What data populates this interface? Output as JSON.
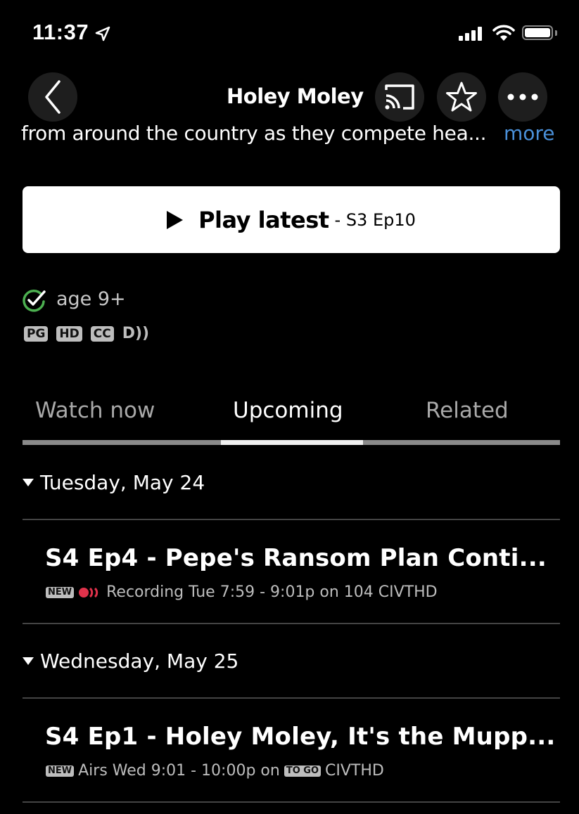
{
  "status_bar": {
    "time": "11:37",
    "icons": [
      "location-arrow-icon",
      "cellular-signal-icon",
      "wifi-icon",
      "battery-icon"
    ]
  },
  "header": {
    "title": "Holey Moley",
    "back_icon": "chevron-left-icon",
    "cast_icon": "cast-icon",
    "favorite_icon": "star-icon",
    "more_icon": "ellipsis-icon"
  },
  "description": {
    "text": "from around the country as they compete hea...",
    "more_label": "more"
  },
  "play_button": {
    "label": "Play latest",
    "episode": "- S3 Ep10"
  },
  "rating": {
    "age_label": "age 9+",
    "badges": [
      "PG",
      "HD",
      "CC"
    ],
    "audio_desc": "D))"
  },
  "tabs": [
    {
      "label": "Watch now",
      "active": false
    },
    {
      "label": "Upcoming",
      "active": true
    },
    {
      "label": "Related",
      "active": false
    }
  ],
  "upcoming": [
    {
      "day": "Tuesday, May 24",
      "episode_title": "S4 Ep4 - Pepe's Ransom Plan Conti...",
      "badge": "NEW",
      "recording": true,
      "meta": "Recording Tue 7:59 - 9:01p on 104 CIVTHD",
      "rec_color": "#e0324b"
    },
    {
      "day": "Wednesday, May 25",
      "episode_title": "S4 Ep1 - Holey Moley, It's the Mupp...",
      "badge": "NEW",
      "recording": false,
      "meta_prefix": "Airs Wed 9:01 - 10:00p on",
      "togo_badge": "TO GO",
      "meta_suffix": "CIVTHD"
    }
  ],
  "colors": {
    "accent_link": "#4a90d9",
    "check_green": "#4caf50",
    "tab_indicator": "#f0f0f0"
  }
}
